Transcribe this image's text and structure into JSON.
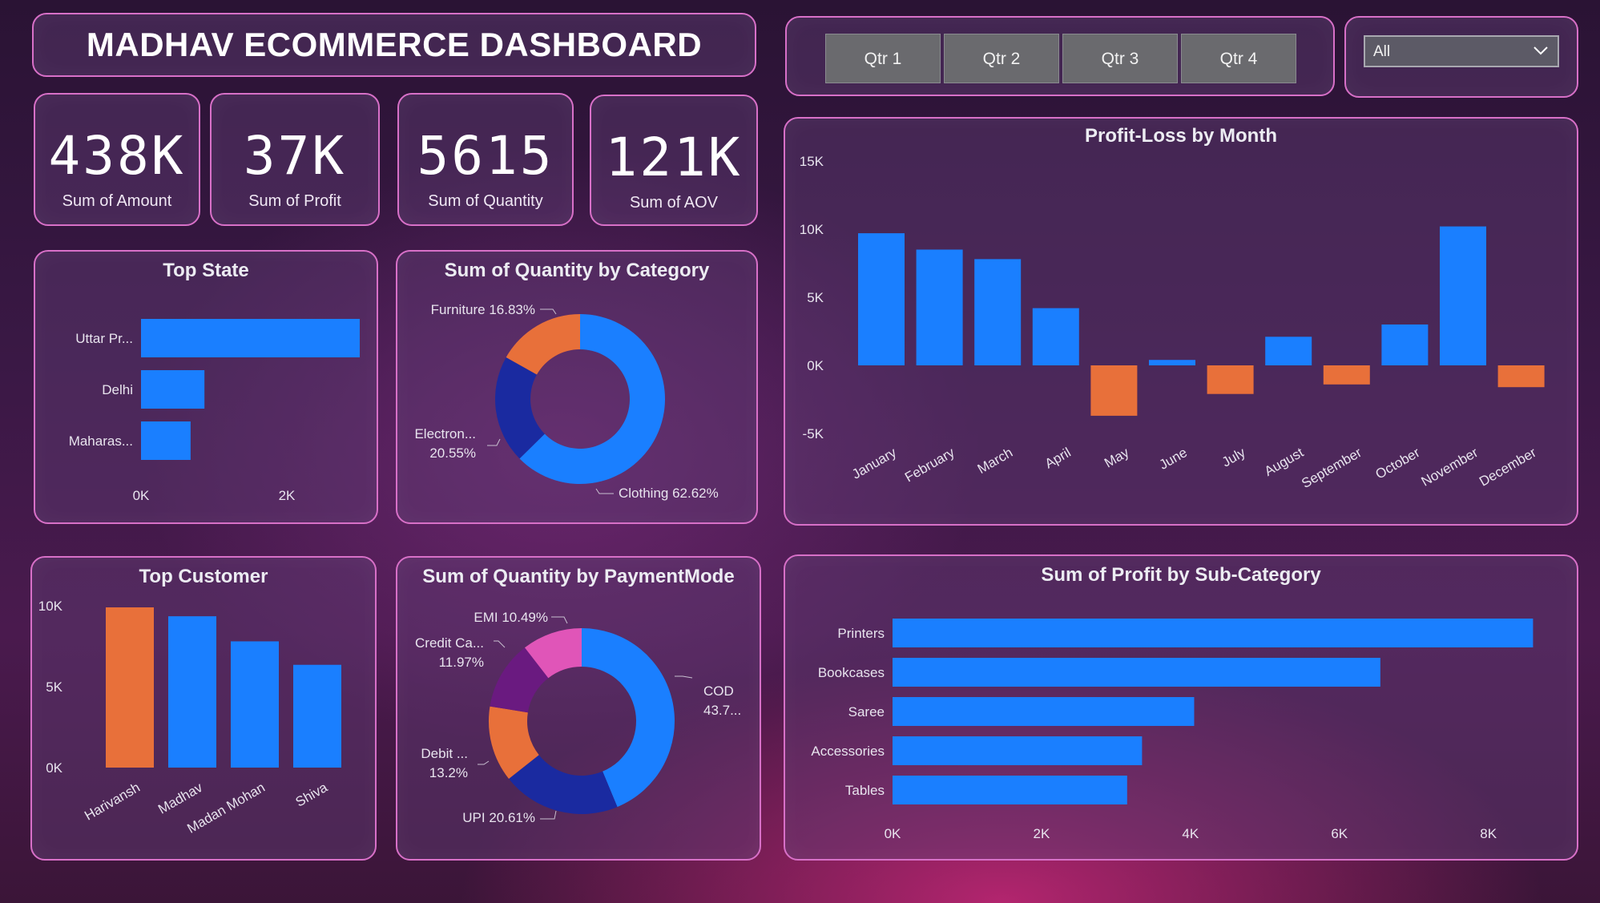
{
  "header": {
    "title": "MADHAV ECOMMERCE DASHBOARD"
  },
  "kpis": [
    {
      "value": "438K",
      "label": "Sum of Amount"
    },
    {
      "value": "37K",
      "label": "Sum of Profit"
    },
    {
      "value": "5615",
      "label": "Sum of Quantity"
    },
    {
      "value": "121K",
      "label": "Sum of AOV"
    }
  ],
  "quarter_slicer": {
    "buttons": [
      "Qtr 1",
      "Qtr 2",
      "Qtr 3",
      "Qtr 4"
    ]
  },
  "state_filter": {
    "selected": "All",
    "icon": "chevron-down-icon"
  },
  "colors": {
    "accent": "#1a7fff",
    "negative": "#e8703a",
    "dark_blue": "#1a2aa0",
    "purple": "#6a1a80",
    "pink": "#e055b8",
    "border": "#d870c8"
  },
  "chart_data": [
    {
      "id": "top_state",
      "type": "bar",
      "orientation": "horizontal",
      "title": "Top State",
      "categories": [
        "Uttar Pr...",
        "Delhi",
        "Maharas..."
      ],
      "values": [
        3000,
        870,
        680
      ],
      "xlim": [
        0,
        3000
      ],
      "xticks": [
        "0K",
        "2K"
      ],
      "xtick_values": [
        0,
        2000
      ]
    },
    {
      "id": "qty_by_category",
      "type": "pie",
      "donut": true,
      "title": "Sum of Quantity by Category",
      "slices": [
        {
          "name": "Clothing",
          "value": 62.62,
          "label": "Clothing 62.62%",
          "color": "#1a7fff"
        },
        {
          "name": "Electronics",
          "value": 20.55,
          "label": [
            "Electron...",
            "20.55%"
          ],
          "color": "#1a2aa0"
        },
        {
          "name": "Furniture",
          "value": 16.83,
          "label": "Furniture 16.83%",
          "color": "#e8703a"
        }
      ]
    },
    {
      "id": "profit_loss_by_month",
      "type": "bar",
      "title": "Profit-Loss by Month",
      "categories": [
        "January",
        "February",
        "March",
        "April",
        "May",
        "June",
        "July",
        "August",
        "September",
        "October",
        "November",
        "December"
      ],
      "values": [
        9700,
        8500,
        7800,
        4200,
        -3700,
        400,
        -2100,
        2100,
        -1400,
        3000,
        10200,
        -1600
      ],
      "ylim": [
        -5000,
        15000
      ],
      "yticks": [
        "-5K",
        "0K",
        "5K",
        "10K",
        "15K"
      ],
      "ytick_values": [
        -5000,
        0,
        5000,
        10000,
        15000
      ]
    },
    {
      "id": "top_customer",
      "type": "bar",
      "title": "Top Customer",
      "categories": [
        "Harivansh",
        "Madhav",
        "Madan Mohan",
        "Shiva"
      ],
      "values": [
        9900,
        9350,
        7800,
        6350
      ],
      "highlight_index": 0,
      "ylim": [
        0,
        10000
      ],
      "yticks": [
        "0K",
        "5K",
        "10K"
      ],
      "ytick_values": [
        0,
        5000,
        10000
      ]
    },
    {
      "id": "qty_by_paymentmode",
      "type": "pie",
      "donut": true,
      "title": "Sum of Quantity by PaymentMode",
      "slices": [
        {
          "name": "COD",
          "value": 43.73,
          "label": [
            "COD",
            "43.7..."
          ],
          "color": "#1a7fff"
        },
        {
          "name": "UPI",
          "value": 20.61,
          "label": "UPI 20.61%",
          "color": "#1a2aa0"
        },
        {
          "name": "Debit Card",
          "value": 13.2,
          "label": [
            "Debit ...",
            "13.2%"
          ],
          "color": "#e8703a"
        },
        {
          "name": "Credit Card",
          "value": 11.97,
          "label": [
            "Credit Ca...",
            "11.97%"
          ],
          "color": "#6a1a80"
        },
        {
          "name": "EMI",
          "value": 10.49,
          "label": "EMI 10.49%",
          "color": "#e055b8"
        }
      ]
    },
    {
      "id": "profit_by_subcategory",
      "type": "bar",
      "orientation": "horizontal",
      "title": "Sum of Profit by Sub-Category",
      "categories": [
        "Printers",
        "Bookcases",
        "Saree",
        "Accessories",
        "Tables"
      ],
      "values": [
        8600,
        6550,
        4050,
        3350,
        3150
      ],
      "xlim": [
        0,
        8800
      ],
      "xticks": [
        "0K",
        "2K",
        "4K",
        "6K",
        "8K"
      ],
      "xtick_values": [
        0,
        2000,
        4000,
        6000,
        8000
      ]
    }
  ]
}
